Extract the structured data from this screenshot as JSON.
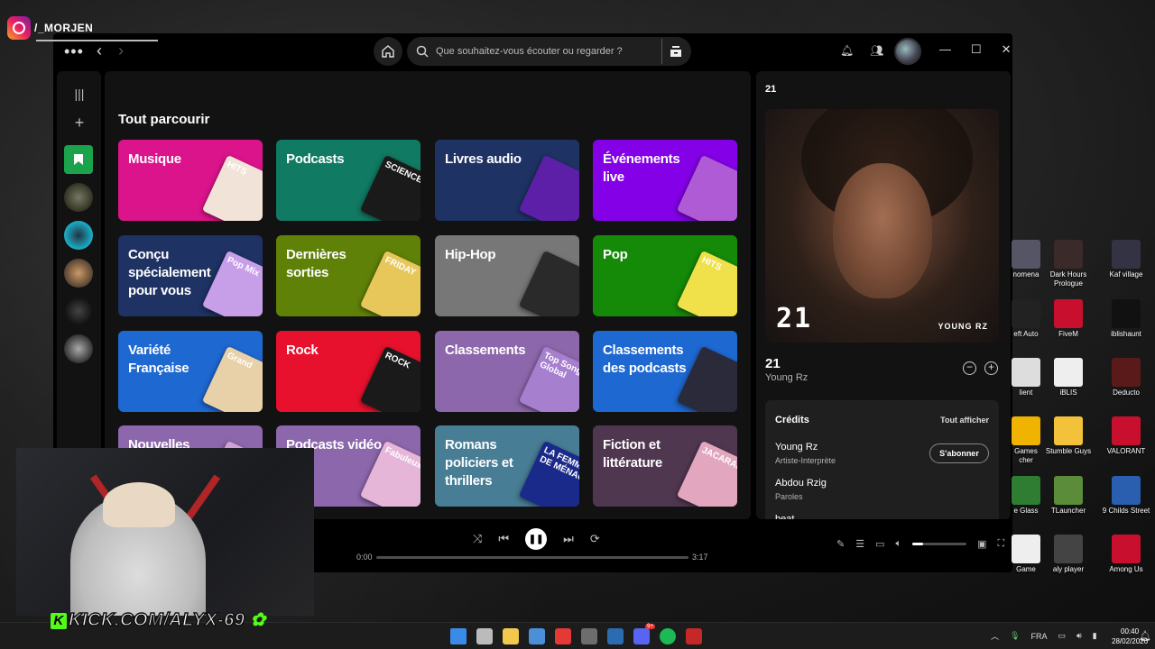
{
  "overlay": {
    "instagram_handle": "/_MORJEN",
    "kick_url": "KICK.COM/ALYX-69",
    "kick_logo": "K"
  },
  "titlebar": {
    "search_placeholder": "Que souhaitez-vous écouter ou regarder ?",
    "icons": [
      "menu-dots-icon",
      "back-icon",
      "forward-icon",
      "home-icon",
      "search-icon",
      "browse-icon",
      "bell-icon",
      "friends-icon",
      "avatar",
      "minimize-icon",
      "maximize-icon",
      "close-icon"
    ]
  },
  "browse": {
    "title": "Tout parcourir",
    "cards": [
      {
        "label": "Musique",
        "color": "#dc148c",
        "art": "#f2e3d8",
        "art_text": "HITS"
      },
      {
        "label": "Podcasts",
        "color": "#117a62",
        "art": "#1a1a1a",
        "art_text": "SCIENCE VS"
      },
      {
        "label": "Livres audio",
        "color": "#1e3264",
        "art": "#5d1fa8",
        "art_text": ""
      },
      {
        "label": "Événements live",
        "color": "#8400e7",
        "art": "#b05bd6",
        "art_text": ""
      },
      {
        "label": "Conçu spécialement pour vous",
        "color": "#1e3264",
        "art": "#c79fe8",
        "art_text": "Pop Mix"
      },
      {
        "label": "Dernières sorties",
        "color": "#608108",
        "art": "#e8c75a",
        "art_text": "FRIDAY"
      },
      {
        "label": "Hip-Hop",
        "color": "#777777",
        "art": "#2a2a2a",
        "art_text": ""
      },
      {
        "label": "Pop",
        "color": "#148a08",
        "art": "#f0e04a",
        "art_text": "HITS"
      },
      {
        "label": "Variété Française",
        "color": "#1e68d1",
        "art": "#e8d0a8",
        "art_text": "Grand"
      },
      {
        "label": "Rock",
        "color": "#e8112d",
        "art": "#1a1a1a",
        "art_text": "ROCK"
      },
      {
        "label": "Classements",
        "color": "#8d67ab",
        "art": "#a77fcf",
        "art_text": "Top Songs Global"
      },
      {
        "label": "Classements des podcasts",
        "color": "#1e68d1",
        "art": "#2a2a3a",
        "art_text": ""
      },
      {
        "label": "Nouvelles sorties",
        "color": "#8d67ab",
        "art": "#cfa2d6",
        "art_text": ""
      },
      {
        "label": "Podcasts vidéo",
        "color": "#8d67ab",
        "art": "#e6b6d8",
        "art_text": "Fabuleux"
      },
      {
        "label": "Romans policiers et thrillers",
        "color": "#477d95",
        "art": "#1a2a8a",
        "art_text": "LA FEMME DE MÉNAGE"
      },
      {
        "label": "Fiction et littérature",
        "color": "#503750",
        "art": "#e3a6bf",
        "art_text": "JACARANDA"
      }
    ]
  },
  "now_playing": {
    "header": "21",
    "cover_text": "21",
    "cover_artist": "YOUNG RZ",
    "title": "21",
    "artist": "Young Rz",
    "credits": {
      "title": "Crédits",
      "show_all": "Tout afficher",
      "follow_label": "S'abonner",
      "people": [
        {
          "name": "Young Rz",
          "role": "Artiste-Interprète"
        },
        {
          "name": "Abdou Rzig",
          "role": "Paroles"
        },
        {
          "name": "beat",
          "role": ""
        }
      ]
    }
  },
  "player": {
    "elapsed": "0:00",
    "duration": "3:17",
    "progress": 0.0,
    "volume": 0.2
  },
  "desktop_icons": [
    {
      "label": "nomena",
      "color": "#556"
    },
    {
      "label": "Dark Hours Prologue",
      "color": "#3a2a2a"
    },
    {
      "label": "Kaf village",
      "color": "#334"
    },
    {
      "label": "eft Auto",
      "color": "#222"
    },
    {
      "label": "FiveM",
      "color": "#c8102e"
    },
    {
      "label": "iblishaunt",
      "color": "#111"
    },
    {
      "label": "lient",
      "color": "#ddd"
    },
    {
      "label": "iBLIS",
      "color": "#eee"
    },
    {
      "label": "Deducto",
      "color": "#5a1a1a"
    },
    {
      "label": "Games cher",
      "color": "#f0b400"
    },
    {
      "label": "Stumble Guys",
      "color": "#f4c23a"
    },
    {
      "label": "VALORANT",
      "color": "#c8102e"
    },
    {
      "label": "e Glass",
      "color": "#2e7d32"
    },
    {
      "label": "TLauncher",
      "color": "#5b8c3a"
    },
    {
      "label": "9 Childs Street",
      "color": "#2a5fb0"
    },
    {
      "label": "Game",
      "color": "#eee"
    },
    {
      "label": "aly player",
      "color": "#444"
    },
    {
      "label": "Among Us",
      "color": "#c8102e"
    }
  ],
  "taskbar": {
    "language": "FRA",
    "time": "00:40",
    "date": "28/02/2026",
    "discord_badge": "9+",
    "app_colors": [
      "#3a8be8",
      "#bbbbbb",
      "#f2c94c",
      "#4a90d9",
      "#e53935",
      "#6d6d6d",
      "#2b6cb0",
      "#5865f2",
      "#1db954",
      "#c62828"
    ]
  }
}
